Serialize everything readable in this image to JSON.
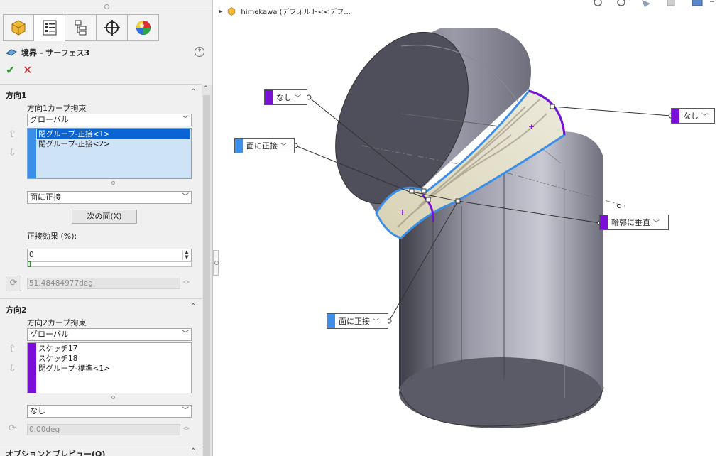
{
  "panel": {
    "title": "境界 - サーフェス3",
    "help": "?",
    "ok": "✔",
    "cancel": "✕",
    "direction1": {
      "title": "方向1",
      "curve_constraint_label": "方向1カーブ拘束",
      "curve_constraint_value": "グローバル",
      "items": [
        "閉グループ-正接<1>",
        "閉グループ-正接<2>"
      ],
      "tangent_type": "面に正接",
      "next_face_button": "次の面(X)",
      "tangent_influence_label": "正接効果 (%):",
      "tangent_influence_value": "0",
      "angle_value": "51.48484977deg"
    },
    "direction2": {
      "title": "方向2",
      "curve_constraint_label": "方向2カーブ拘束",
      "curve_constraint_value": "グローバル",
      "items": [
        "スケッチ17",
        "スケッチ18",
        "閉グループ-標準<1>"
      ],
      "tangent_type": "なし",
      "angle_value": "0.00deg"
    },
    "options_title": "オプションとプレビュー(O)",
    "colors": {
      "dir1": "#3b8fe8",
      "dir2": "#7a10d8"
    }
  },
  "tree": {
    "label": "himekawa (デフォルト<<デフ..."
  },
  "callouts": {
    "c1": "なし",
    "c2": "なし",
    "c3": "面に正接",
    "c4": "輪郭に垂直",
    "c5": "面に正接"
  }
}
